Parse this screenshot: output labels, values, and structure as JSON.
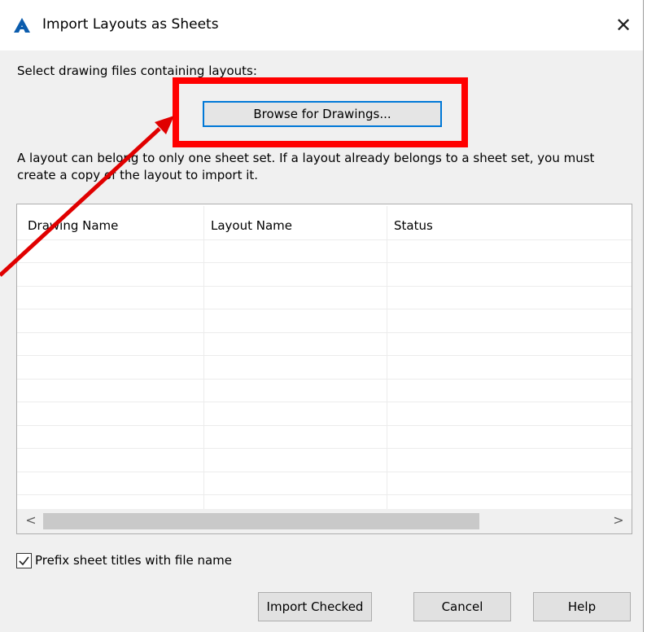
{
  "window": {
    "title": "Import Layouts as Sheets",
    "app_icon": "autocad-a-icon",
    "close_glyph": "✕"
  },
  "instruction": "Select drawing files containing layouts:",
  "browse_button": {
    "label": "Browse for Drawings..."
  },
  "note": "A layout can belong to only one sheet set. If a layout already belongs to a sheet set, you must create a copy of the layout to import it.",
  "table": {
    "columns": [
      "Drawing Name",
      "Layout Name",
      "Status"
    ],
    "rows": [],
    "scroll_left": "<",
    "scroll_right": ">"
  },
  "prefix_option": {
    "label": "Prefix sheet titles with file name",
    "checked": true
  },
  "buttons": {
    "import": "Import Checked",
    "cancel": "Cancel",
    "help": "Help"
  },
  "annotation": {
    "color": "#ff0000",
    "target": "browse_button"
  },
  "colors": {
    "focus_border": "#0078d7",
    "dialog_bg": "#f0f0f0",
    "app_icon": "#0b5cad"
  }
}
